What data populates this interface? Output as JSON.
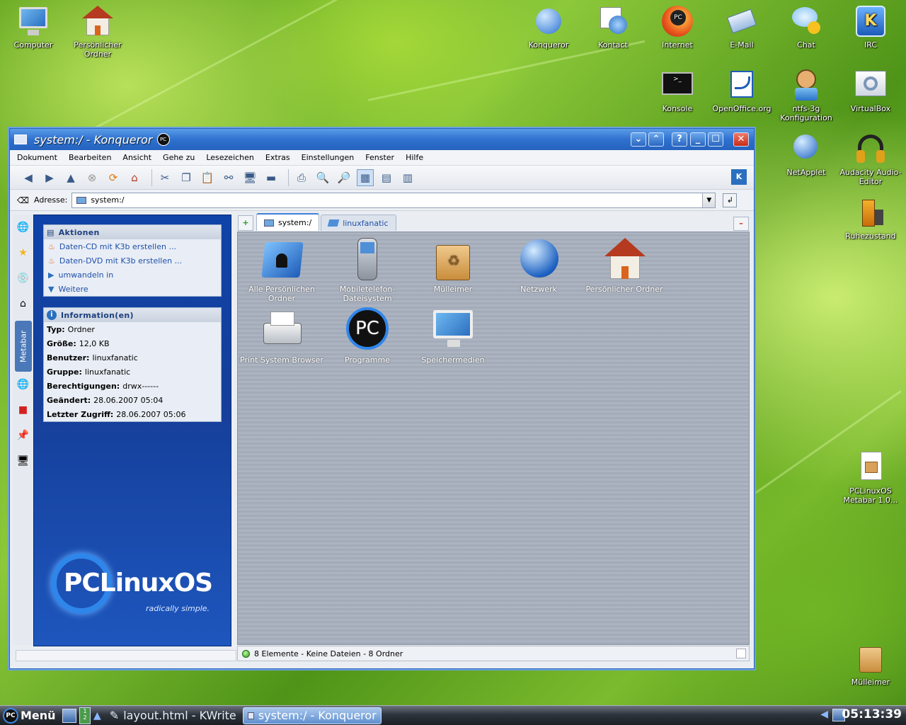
{
  "desktop": {
    "icons": [
      {
        "label": "Computer",
        "icon": "monitor-icon"
      },
      {
        "label": "Persönlicher Ordner",
        "icon": "home-icon"
      },
      {
        "label": "Konqueror",
        "icon": "globe-gear-icon"
      },
      {
        "label": "Kontact",
        "icon": "calendar-mail-icon"
      },
      {
        "label": "Internet",
        "icon": "firefox-icon"
      },
      {
        "label": "E-Mail",
        "icon": "mail-icon"
      },
      {
        "label": "Chat",
        "icon": "chat-bubble-icon"
      },
      {
        "label": "IRC",
        "icon": "irc-icon"
      },
      {
        "label": "Konsole",
        "icon": "terminal-icon"
      },
      {
        "label": "OpenOffice.org",
        "icon": "openoffice-icon"
      },
      {
        "label": "ntfs-3g Konfiguration",
        "icon": "ntfs-icon"
      },
      {
        "label": "VirtualBox",
        "icon": "virtualbox-icon"
      },
      {
        "label": "NetApplet",
        "icon": "network-globe-icon"
      },
      {
        "label": "Audacity Audio-Editor",
        "icon": "headphones-icon"
      },
      {
        "label": "Ruhezustand",
        "icon": "battery-icon"
      },
      {
        "label": "PCLinuxOS Metabar 1.0...",
        "icon": "package-file-icon"
      },
      {
        "label": "Mülleimer",
        "icon": "trash-icon"
      }
    ]
  },
  "window": {
    "title": "system:/ - Konqueror",
    "menu": [
      "Dokument",
      "Bearbeiten",
      "Ansicht",
      "Gehe zu",
      "Lesezeichen",
      "Extras",
      "Einstellungen",
      "Fenster",
      "Hilfe"
    ],
    "address_label": "Adresse:",
    "address_value": "system:/",
    "tabs": [
      "system:/",
      "linuxfanatic"
    ],
    "vertical_tab_label": "Metabar",
    "actions": {
      "header": "Aktionen",
      "items": [
        "Daten-CD mit K3b erstellen ...",
        "Daten-DVD mit K3b erstellen ...",
        "umwandeln in",
        "Weitere"
      ]
    },
    "info": {
      "header": "Information(en)",
      "rows": [
        {
          "label": "Typ:",
          "value": "Ordner"
        },
        {
          "label": "Größe:",
          "value": "12,0 KB"
        },
        {
          "label": "Benutzer:",
          "value": "linuxfanatic"
        },
        {
          "label": "Gruppe:",
          "value": "linuxfanatic"
        },
        {
          "label": "Berechtigungen:",
          "value": "drwx------"
        },
        {
          "label": "Geändert:",
          "value": "28.06.2007 05:04"
        },
        {
          "label": "Letzter Zugriff:",
          "value": "28.06.2007 05:06"
        }
      ]
    },
    "logo_text": "PCLinuxOS",
    "logo_tagline": "radically simple.",
    "files": [
      {
        "label": "Alle Persönlichen Ordner",
        "icon": "folder-user-icon"
      },
      {
        "label": "Mobiletelefon-Dateisystem",
        "icon": "mobile-phone-icon"
      },
      {
        "label": "Mülleimer",
        "icon": "trash-icon"
      },
      {
        "label": "Netzwerk",
        "icon": "network-globe-icon"
      },
      {
        "label": "Persönlicher Ordner",
        "icon": "home-icon"
      },
      {
        "label": "Print System Browser",
        "icon": "printer-icon"
      },
      {
        "label": "Programme",
        "icon": "pc-logo-icon"
      },
      {
        "label": "Speichermedien",
        "icon": "monitor-icon"
      }
    ],
    "status": "8 Elemente - Keine Dateien - 8 Ordner"
  },
  "taskbar": {
    "start_label": "Menü",
    "start_badge": "PC",
    "tasks": [
      "layout.html - KWrite",
      "system:/ - Konqueror"
    ],
    "clock": "05:13:39"
  }
}
